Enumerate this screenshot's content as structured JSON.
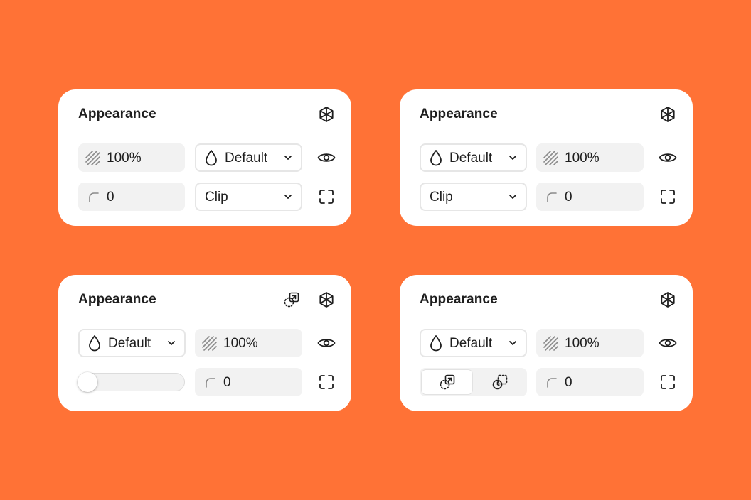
{
  "colors": {
    "background": "#ff7236",
    "panel": "#ffffff",
    "field": "#f2f2f2",
    "text": "#1e1e1e"
  },
  "panels": [
    {
      "title": "Appearance",
      "opacity": "100%",
      "blend_mode": "Default",
      "radius": "0",
      "overflow": "Clip",
      "icons": [
        "styles-icon",
        "opacity-icon",
        "drop-icon",
        "chevron-down-icon",
        "eye-icon",
        "corner-radius-icon",
        "chevron-down-icon",
        "expand-corners-icon"
      ]
    },
    {
      "title": "Appearance",
      "blend_mode": "Default",
      "opacity": "100%",
      "overflow": "Clip",
      "radius": "0",
      "icons": [
        "styles-icon",
        "drop-icon",
        "opacity-icon",
        "eye-icon",
        "chevron-down-icon",
        "corner-radius-icon",
        "expand-corners-icon"
      ]
    },
    {
      "title": "Appearance",
      "blend_mode": "Default",
      "opacity": "100%",
      "radius": "0",
      "slider_value": 0,
      "icons": [
        "clip-content-icon",
        "styles-icon",
        "drop-icon",
        "chevron-down-icon",
        "opacity-icon",
        "eye-icon",
        "corner-radius-icon",
        "expand-corners-icon"
      ]
    },
    {
      "title": "Appearance",
      "blend_mode": "Default",
      "opacity": "100%",
      "radius": "0",
      "segment_options": [
        "clip-content-icon",
        "clip-timer-icon"
      ],
      "segment_selected": 0,
      "icons": [
        "styles-icon",
        "drop-icon",
        "chevron-down-icon",
        "opacity-icon",
        "eye-icon",
        "corner-radius-icon",
        "expand-corners-icon"
      ]
    }
  ]
}
